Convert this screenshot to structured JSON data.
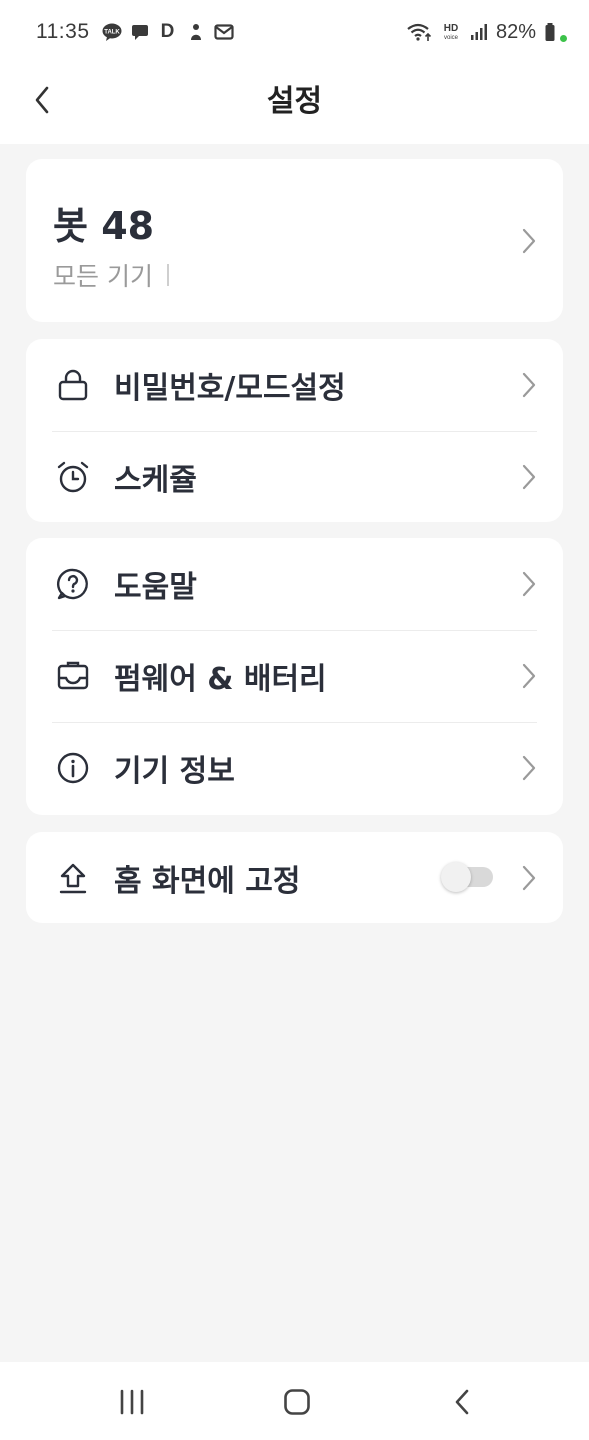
{
  "status_bar": {
    "time": "11:35",
    "notification_icons": [
      "talk-icon",
      "message-icon",
      "d-app-icon",
      "person-icon",
      "mail-icon"
    ],
    "d_label": "D",
    "right_icons": [
      "wifi-icon",
      "hd-voice-icon",
      "signal-icon"
    ],
    "battery_percent": "82%"
  },
  "header": {
    "title": "설정",
    "back_icon": "chevron-left-icon"
  },
  "device": {
    "name": "봇 48",
    "subtitle": "모든 기기"
  },
  "security_section": {
    "items": [
      {
        "label": "비밀번호/모드설정",
        "icon": "lock-icon"
      },
      {
        "label": "스케쥴",
        "icon": "alarm-clock-icon"
      }
    ]
  },
  "help_section": {
    "items": [
      {
        "label": "도움말",
        "icon": "help-bubble-icon"
      },
      {
        "label": "펌웨어 & 배터리",
        "icon": "firmware-icon"
      },
      {
        "label": "기기 정보",
        "icon": "info-icon"
      }
    ]
  },
  "pin_section": {
    "label": "홈 화면에 고정",
    "icon": "upload-pin-icon",
    "toggle_on": false
  },
  "colors": {
    "background": "#f5f5f5",
    "card": "#ffffff",
    "text_primary": "#2b2f3a",
    "text_secondary": "#9a9a9a",
    "chevron": "#9a9a9a"
  },
  "nav_bar": {
    "icons": [
      "recent-apps-icon",
      "home-icon",
      "back-icon"
    ]
  }
}
